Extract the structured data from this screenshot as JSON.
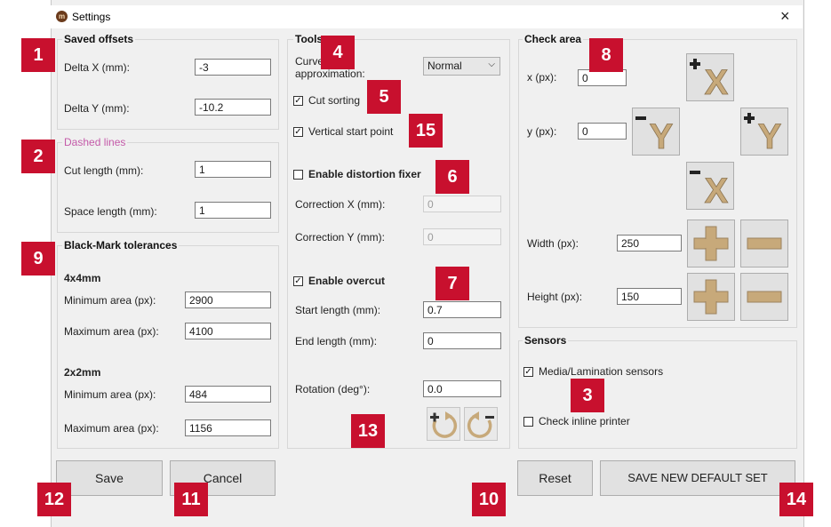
{
  "window": {
    "title": "Settings",
    "close_glyph": "×",
    "app_icon": "app-logo-icon"
  },
  "saved_offsets": {
    "title": "Saved offsets",
    "delta_x_label": "Delta X (mm):",
    "delta_x_value": "-3",
    "delta_y_label": "Delta Y (mm):",
    "delta_y_value": "-10.2"
  },
  "dashed_lines": {
    "title": "Dashed lines",
    "cut_length_label": "Cut length (mm):",
    "cut_length_value": "1",
    "space_length_label": "Space length (mm):",
    "space_length_value": "1"
  },
  "black_mark": {
    "title": "Black-Mark tolerances",
    "group1_title": "4x4mm",
    "group1_min_label": "Minimum area (px):",
    "group1_min_value": "2900",
    "group1_max_label": "Maximum area (px):",
    "group1_max_value": "4100",
    "group2_title": "2x2mm",
    "group2_min_label": "Minimum area (px):",
    "group2_min_value": "484",
    "group2_max_label": "Maximum area (px):",
    "group2_max_value": "1156"
  },
  "tools": {
    "title": "Tools",
    "curve_label_1": "Curve",
    "curve_label_2": "approximation:",
    "curve_selected": "Normal",
    "cut_sorting_label": "Cut sorting",
    "cut_sorting_checked": true,
    "vertical_start_label": "Vertical start point",
    "vertical_start_checked": true,
    "distortion_label": "Enable distortion fixer",
    "distortion_checked": false,
    "correction_x_label": "Correction X (mm):",
    "correction_x_value": "0",
    "correction_y_label": "Correction Y (mm):",
    "correction_y_value": "0",
    "overcut_label": "Enable overcut",
    "overcut_checked": true,
    "start_length_label": "Start length (mm):",
    "start_length_value": "0.7",
    "end_length_label": "End length (mm):",
    "end_length_value": "0",
    "rotation_label": "Rotation (deg°):",
    "rotation_value": "0.0"
  },
  "check_area": {
    "title": "Check area",
    "x_label": "x (px):",
    "x_value": "0",
    "y_label": "y (px):",
    "y_value": "0",
    "width_label": "Width (px):",
    "width_value": "250",
    "height_label": "Height (px):",
    "height_value": "150",
    "accent": "#c7a97a"
  },
  "sensors": {
    "title": "Sensors",
    "media_label": "Media/Lamination sensors",
    "media_checked": true,
    "inline_label": "Check inline printer",
    "inline_checked": false
  },
  "buttons": {
    "save": "Save",
    "cancel": "Cancel",
    "reset": "Reset",
    "save_default": "SAVE NEW DEFAULT SET"
  },
  "badges": {
    "b1": "1",
    "b2": "2",
    "b3": "3",
    "b4": "4",
    "b5": "5",
    "b6": "6",
    "b7": "7",
    "b8": "8",
    "b9": "9",
    "b10": "10",
    "b11": "11",
    "b12": "12",
    "b13": "13",
    "b14": "14",
    "b15": "15",
    "color": "#c8102e"
  },
  "glyphs": {
    "check": "✓",
    "dropdown": "⌵",
    "letter_x": "X",
    "letter_y": "Y"
  }
}
